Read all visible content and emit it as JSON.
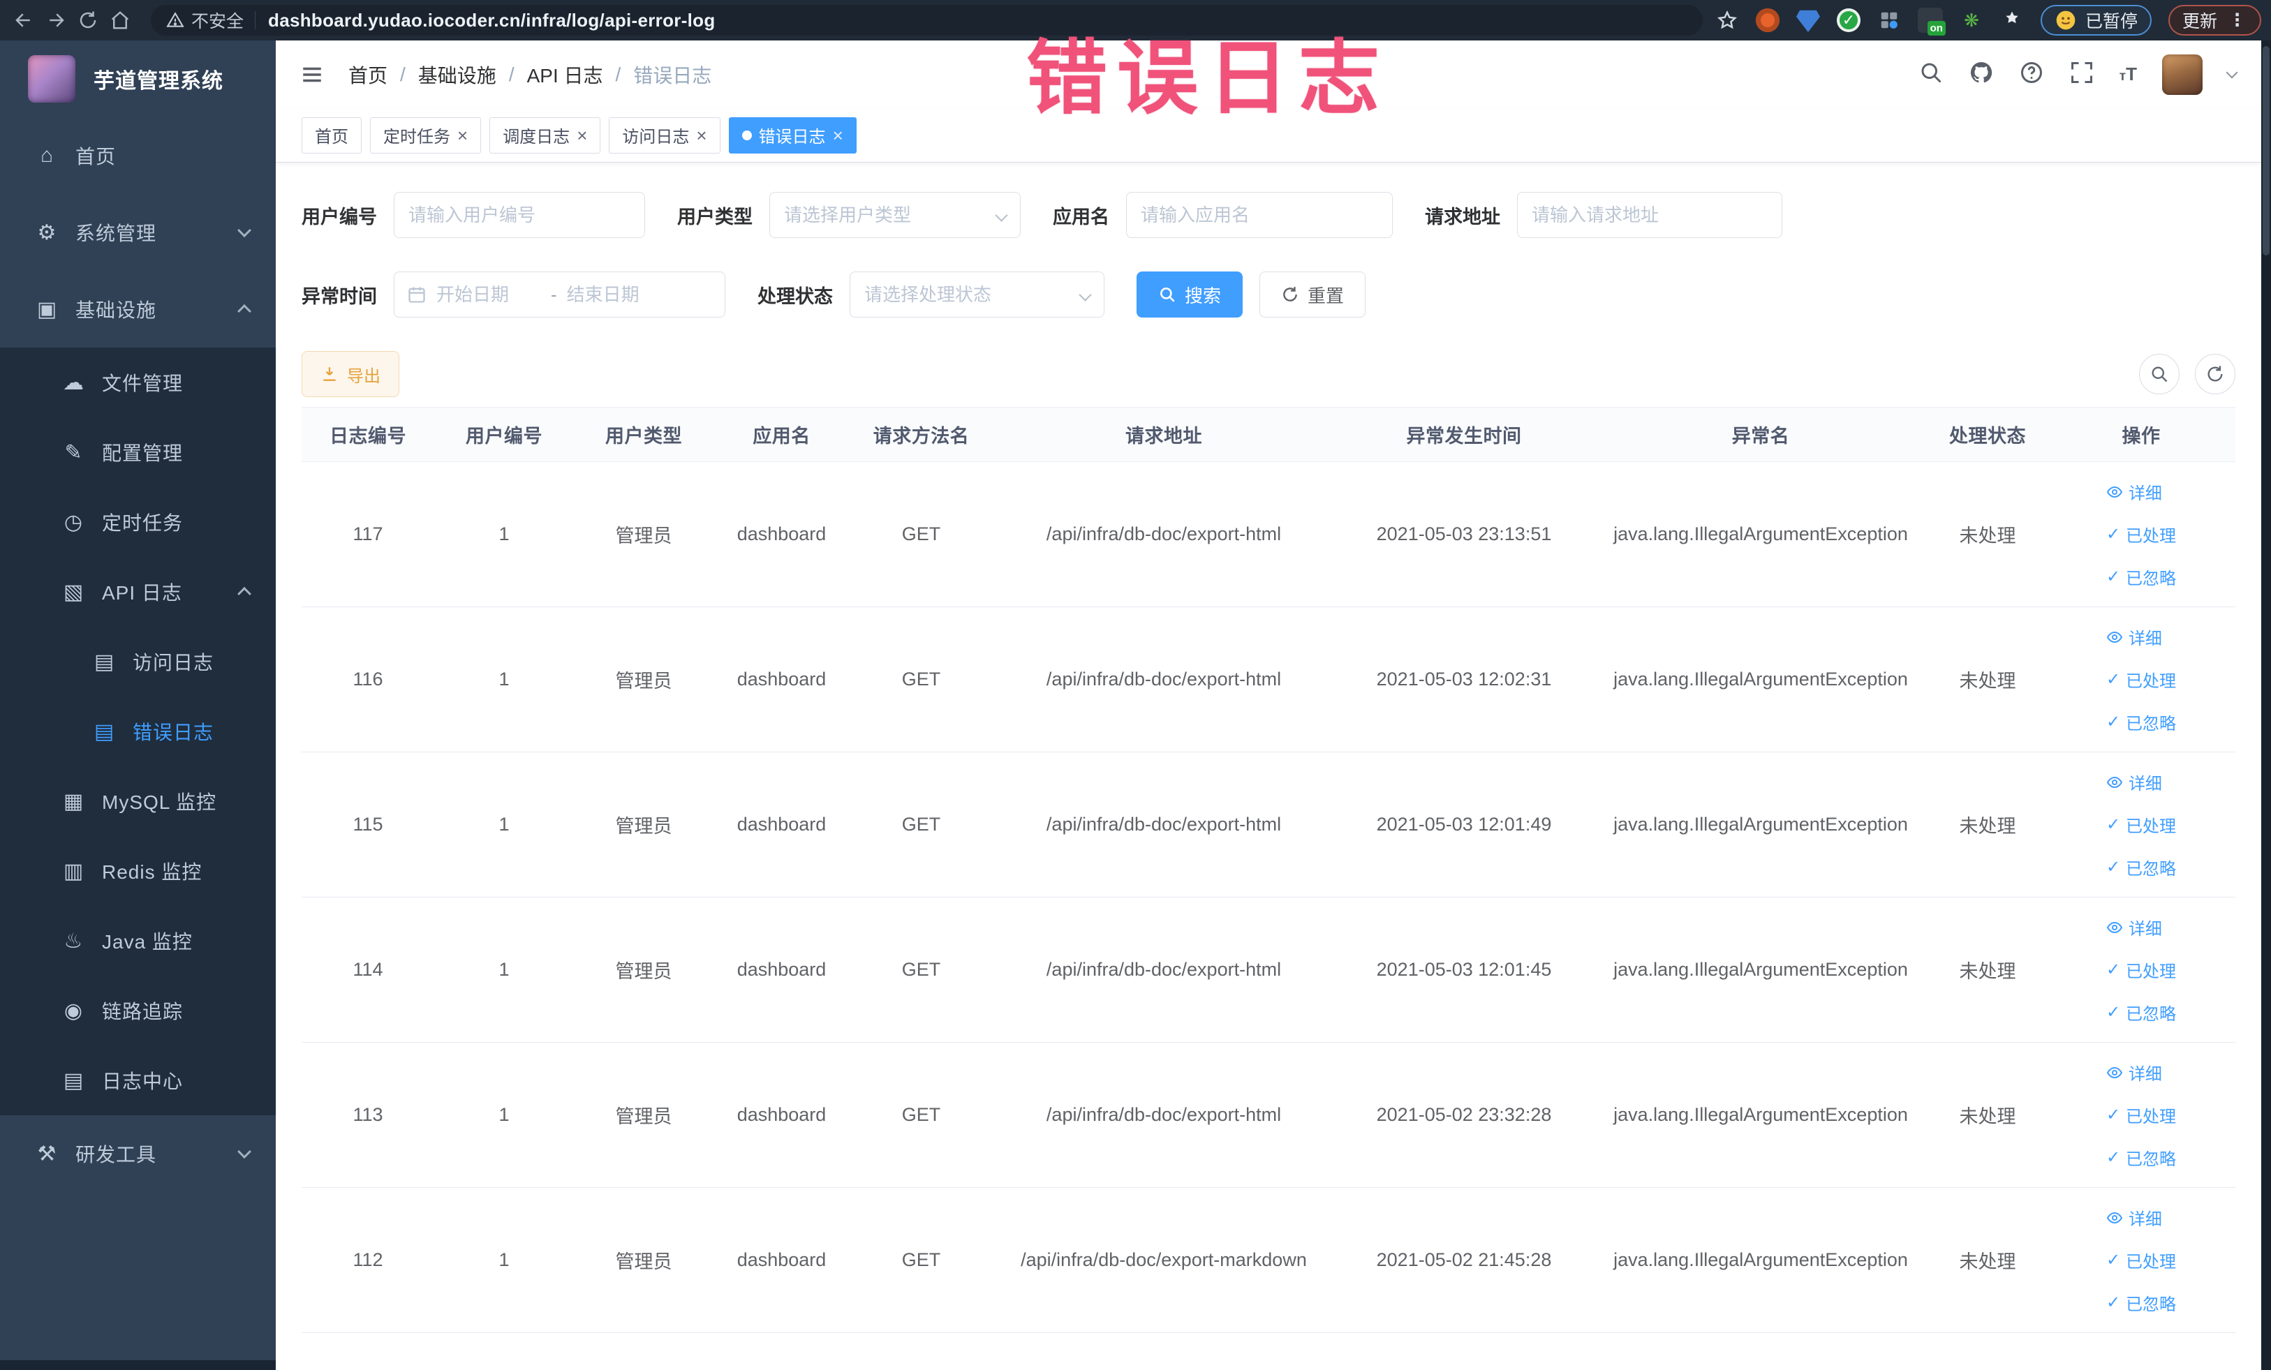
{
  "colors": {
    "accent": "#409eff",
    "warning": "#e6a23c",
    "watermark": "#f0527a",
    "sidebar_bg": "#304156",
    "submenu_bg": "#1f2d3d"
  },
  "browser": {
    "security_label": "不安全",
    "url": "dashboard.yudao.iocoder.cn/infra/log/api-error-log",
    "paused_button": "已暂停",
    "update_button": "更新",
    "on_badge": "on"
  },
  "overlay": {
    "watermark": "错误日志"
  },
  "sidebar": {
    "title": "芋道管理系统",
    "items": [
      {
        "label": "首页",
        "icon": "home",
        "depth": 0,
        "caret": null,
        "active": false,
        "dark": false
      },
      {
        "label": "系统管理",
        "icon": "gear",
        "depth": 0,
        "caret": "down",
        "active": false,
        "dark": false
      },
      {
        "label": "基础设施",
        "icon": "monitor",
        "depth": 0,
        "caret": "up",
        "active": false,
        "dark": false
      },
      {
        "label": "文件管理",
        "icon": "cloud",
        "depth": 1,
        "caret": null,
        "active": false,
        "dark": true
      },
      {
        "label": "配置管理",
        "icon": "edit",
        "depth": 1,
        "caret": null,
        "active": false,
        "dark": true
      },
      {
        "label": "定时任务",
        "icon": "timer",
        "depth": 1,
        "caret": null,
        "active": false,
        "dark": true
      },
      {
        "label": "API 日志",
        "icon": "api-log",
        "depth": 1,
        "caret": "up",
        "active": false,
        "dark": true
      },
      {
        "label": "访问日志",
        "icon": "doc",
        "depth": 2,
        "caret": null,
        "active": false,
        "dark": true
      },
      {
        "label": "错误日志",
        "icon": "doc",
        "depth": 2,
        "caret": null,
        "active": true,
        "dark": true
      },
      {
        "label": "MySQL 监控",
        "icon": "mysql",
        "depth": 1,
        "caret": null,
        "active": false,
        "dark": true
      },
      {
        "label": "Redis 监控",
        "icon": "redis",
        "depth": 1,
        "caret": null,
        "active": false,
        "dark": true
      },
      {
        "label": "Java 监控",
        "icon": "java",
        "depth": 1,
        "caret": null,
        "active": false,
        "dark": true
      },
      {
        "label": "链路追踪",
        "icon": "trace",
        "depth": 1,
        "caret": null,
        "active": false,
        "dark": true
      },
      {
        "label": "日志中心",
        "icon": "log-center",
        "depth": 1,
        "caret": null,
        "active": false,
        "dark": true
      },
      {
        "label": "研发工具",
        "icon": "toolbox",
        "depth": 0,
        "caret": "down",
        "active": false,
        "dark": false
      }
    ]
  },
  "header": {
    "breadcrumbs": [
      "首页",
      "基础设施",
      "API 日志",
      "错误日志"
    ],
    "separator": "/"
  },
  "tabs": [
    {
      "label": "首页",
      "closable": false,
      "active": false
    },
    {
      "label": "定时任务",
      "closable": true,
      "active": false
    },
    {
      "label": "调度日志",
      "closable": true,
      "active": false
    },
    {
      "label": "访问日志",
      "closable": true,
      "active": false
    },
    {
      "label": "错误日志",
      "closable": true,
      "active": true
    }
  ],
  "filters": {
    "user_id": {
      "label": "用户编号",
      "placeholder": "请输入用户编号"
    },
    "user_type": {
      "label": "用户类型",
      "placeholder": "请选择用户类型"
    },
    "app_name": {
      "label": "应用名",
      "placeholder": "请输入应用名"
    },
    "request_url": {
      "label": "请求地址",
      "placeholder": "请输入请求地址"
    },
    "exception_time": {
      "label": "异常时间",
      "start_placeholder": "开始日期",
      "separator": "-",
      "end_placeholder": "结束日期"
    },
    "process_status": {
      "label": "处理状态",
      "placeholder": "请选择处理状态"
    },
    "search_button": "搜索",
    "reset_button": "重置"
  },
  "toolbar": {
    "export_label": "导出"
  },
  "table": {
    "columns": [
      "日志编号",
      "用户编号",
      "用户类型",
      "应用名",
      "请求方法名",
      "请求地址",
      "异常发生时间",
      "异常名",
      "处理状态",
      "操作"
    ],
    "row_actions": [
      "详细",
      "已处理",
      "已忽略"
    ],
    "rows": [
      {
        "id": "117",
        "user_id": "1",
        "user_type": "管理员",
        "app": "dashboard",
        "method": "GET",
        "url": "/api/infra/db-doc/export-html",
        "time": "2021-05-03 23:13:51",
        "exception": "java.lang.IllegalArgumentException",
        "status": "未处理"
      },
      {
        "id": "116",
        "user_id": "1",
        "user_type": "管理员",
        "app": "dashboard",
        "method": "GET",
        "url": "/api/infra/db-doc/export-html",
        "time": "2021-05-03 12:02:31",
        "exception": "java.lang.IllegalArgumentException",
        "status": "未处理"
      },
      {
        "id": "115",
        "user_id": "1",
        "user_type": "管理员",
        "app": "dashboard",
        "method": "GET",
        "url": "/api/infra/db-doc/export-html",
        "time": "2021-05-03 12:01:49",
        "exception": "java.lang.IllegalArgumentException",
        "status": "未处理"
      },
      {
        "id": "114",
        "user_id": "1",
        "user_type": "管理员",
        "app": "dashboard",
        "method": "GET",
        "url": "/api/infra/db-doc/export-html",
        "time": "2021-05-03 12:01:45",
        "exception": "java.lang.IllegalArgumentException",
        "status": "未处理"
      },
      {
        "id": "113",
        "user_id": "1",
        "user_type": "管理员",
        "app": "dashboard",
        "method": "GET",
        "url": "/api/infra/db-doc/export-html",
        "time": "2021-05-02 23:32:28",
        "exception": "java.lang.IllegalArgumentException",
        "status": "未处理"
      },
      {
        "id": "112",
        "user_id": "1",
        "user_type": "管理员",
        "app": "dashboard",
        "method": "GET",
        "url": "/api/infra/db-doc/export-markdown",
        "time": "2021-05-02 21:45:28",
        "exception": "java.lang.IllegalArgumentException",
        "status": "未处理"
      }
    ]
  }
}
